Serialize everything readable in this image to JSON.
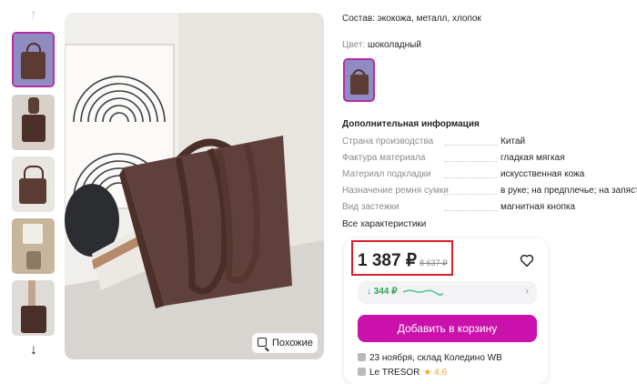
{
  "gallery": {
    "up_icon": "arrow-up-icon",
    "down_icon": "arrow-down-icon",
    "similar_label": "Похожие"
  },
  "info": {
    "composition": "Состав: экокожа, металл, хлопок",
    "color_label": "Цвет:",
    "color_value": "шоколадный",
    "additional_title": "Дополнительная информация",
    "properties": [
      {
        "key": "Страна производства",
        "value": "Китай"
      },
      {
        "key": "Фактура материала",
        "value": "гладкая мягкая"
      },
      {
        "key": "Материал подкладки",
        "value": "искусственная кожа"
      },
      {
        "key": "Назначение ремня сумки",
        "value": "в руке; на предплечье; на запястье"
      },
      {
        "key": "Вид застежки",
        "value": "магнитная кнопка"
      }
    ],
    "all_properties_link": "Все характеристики"
  },
  "buy_card": {
    "price": "1 387 ₽",
    "old_price": "8 637 ₽",
    "price_drop": "↓ 344 ₽",
    "add_to_cart": "Добавить в корзину",
    "delivery": "23 ноября, склад Коледино WB",
    "seller_name": "Le TRESOR",
    "rating": "★ 4.6",
    "accent_color": "#cb11ab",
    "highlight_color": "#d81e2a"
  }
}
